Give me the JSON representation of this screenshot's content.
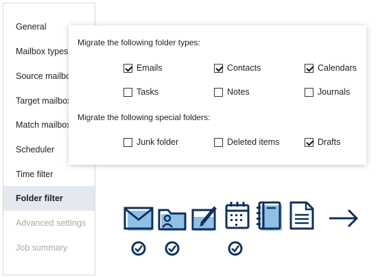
{
  "sidebar": {
    "items": [
      {
        "label": "General",
        "state": "normal"
      },
      {
        "label": "Mailbox types",
        "state": "normal"
      },
      {
        "label": "Source mailboxes",
        "state": "normal"
      },
      {
        "label": "Target mailboxes",
        "state": "normal"
      },
      {
        "label": "Match mailboxes",
        "state": "normal"
      },
      {
        "label": "Scheduler",
        "state": "normal"
      },
      {
        "label": "Time filter",
        "state": "normal"
      },
      {
        "label": "Folder filter",
        "state": "active"
      },
      {
        "label": "Advanced settings",
        "state": "disabled"
      },
      {
        "label": "Job summary",
        "state": "disabled"
      }
    ]
  },
  "folder_types": {
    "title": "Migrate the following folder types:",
    "options": [
      {
        "label": "Emails",
        "checked": true
      },
      {
        "label": "Contacts",
        "checked": true
      },
      {
        "label": "Calendars",
        "checked": true
      },
      {
        "label": "Tasks",
        "checked": false
      },
      {
        "label": "Notes",
        "checked": false
      },
      {
        "label": "Journals",
        "checked": false
      }
    ]
  },
  "special_folders": {
    "title": "Migrate the following special folders:",
    "options": [
      {
        "label": "Junk folder",
        "checked": false
      },
      {
        "label": "Deleted items",
        "checked": false
      },
      {
        "label": "Drafts",
        "checked": true
      }
    ]
  },
  "illustration": {
    "icons": [
      "envelope-icon",
      "contact-folder-icon",
      "note-pencil-icon",
      "calendar-icon",
      "journal-icon",
      "document-icon",
      "arrow-right-icon"
    ],
    "selected_marks": [
      "envelope-icon",
      "contact-folder-icon",
      "calendar-icon"
    ]
  },
  "colors": {
    "navy": "#0f2f5c",
    "light_blue": "#8fc0e6",
    "active_bg": "#e4e8ef",
    "disabled_text": "#a9a9a9"
  }
}
